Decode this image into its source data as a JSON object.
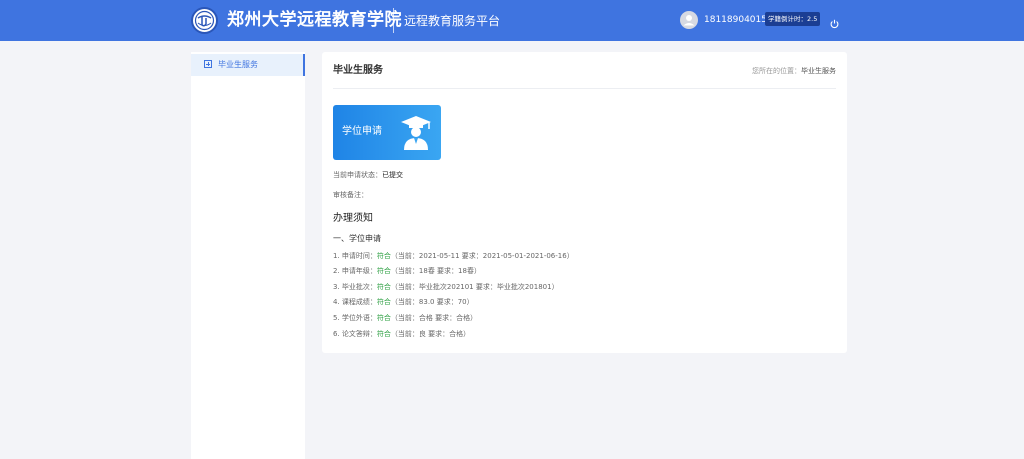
{
  "header": {
    "brand": "郑州大学远程教育学院",
    "platform": "远程教育服务平台",
    "phone": "18118904015",
    "timer": "学籍倒计时：2.5"
  },
  "sidebar": {
    "items": [
      {
        "label": "毕业生服务"
      }
    ]
  },
  "main": {
    "title": "毕业生服务",
    "breadcrumb_prefix": "您所在的位置：",
    "breadcrumb_current": "毕业生服务",
    "apply_card_label": "学位申请",
    "status_label": "当前申请状态：",
    "status_value": "已提交",
    "review_label": "审核备注：",
    "notice_title": "办理须知",
    "section_title": "一、学位申请",
    "rules": [
      {
        "prefix": "1. 申请时间：",
        "status": "符合",
        "detail": "（当前：2021-05-11 要求：2021-05-01-2021-06-16）"
      },
      {
        "prefix": "2. 申请年级：",
        "status": "符合",
        "detail": "（当前：18春 要求：18春）"
      },
      {
        "prefix": "3. 毕业批次：",
        "status": "符合",
        "detail": "（当前：毕业批次202101 要求：毕业批次201801）"
      },
      {
        "prefix": "4. 课程成绩：",
        "status": "符合",
        "detail": "（当前：83.0 要求：70）"
      },
      {
        "prefix": "5. 学位外语：",
        "status": "符合",
        "detail": "（当前：合格 要求：合格）"
      },
      {
        "prefix": "6. 论文答辩：",
        "status": "符合",
        "detail": "（当前：良 要求：合格）"
      }
    ]
  },
  "colors": {
    "header": "#3f74e0",
    "accent": "#3f74e0",
    "ok": "#2ea043",
    "card": "#1f84e6"
  },
  "icons": [
    "university-logo-icon",
    "user-avatar-icon",
    "power-icon",
    "plus-square-icon",
    "graduate-icon"
  ]
}
